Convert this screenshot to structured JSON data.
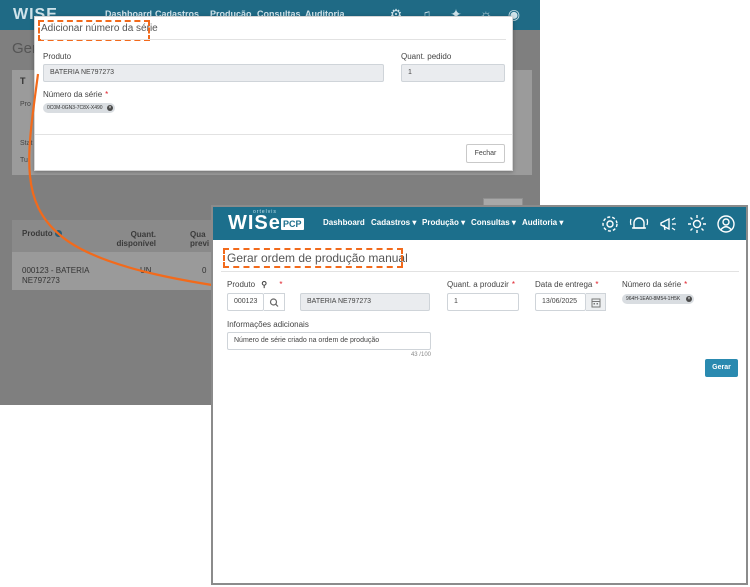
{
  "background_app": {
    "brand": "WISE",
    "nav": [
      "Dashboard",
      "Cadastros",
      "Produção",
      "Consultas",
      "Auditoria"
    ],
    "page_title": "Gera",
    "card_title": "T",
    "card_label_a": "Pro",
    "card_label_b": "Stat",
    "card_label_c": "Tu",
    "table_headers": [
      "Produto",
      "Quant. disponível",
      "Qua previ"
    ],
    "table_row": {
      "product_line1": "000123 - BATERIA",
      "product_line2": "NE797273",
      "unit": "UN",
      "qty": "0"
    }
  },
  "modal": {
    "title": "Adicionar número da série",
    "produto_label": "Produto",
    "produto_value": "BATERIA NE797273",
    "quant_label": "Quant. pedido",
    "quant_value": "1",
    "serie_label": "Número da série",
    "serie_required": "*",
    "serie_chip": "0C0M-0GN3-7C8X-X490",
    "fechar_label": "Fechar"
  },
  "window": {
    "brand": "WISe",
    "brand_badge": "PCP",
    "brand_sub": "ortelvis",
    "nav": {
      "dashboard": "Dashboard",
      "cadastros": "Cadastros",
      "producao": "Produção",
      "consultas": "Consultas",
      "auditoria": "Auditoria"
    },
    "page_title": "Gerar ordem de produção manual",
    "form": {
      "produto_label": "Produto",
      "produto_required": "*",
      "produto_code": "000123",
      "produto_name": "BATERIA NE797273",
      "quant_label": "Quant. a produzir",
      "quant_required": "*",
      "quant_value": "1",
      "data_label": "Data de entrega",
      "data_required": "*",
      "data_value": "13/06/2025",
      "serie_label": "Número da série",
      "serie_required": "*",
      "serie_chip": "964H-1EA0-8M54-1H5K",
      "info_label": "Informações adicionais",
      "info_value": "Número de série criado na ordem de produção",
      "char_count": "43 /100"
    },
    "gerar_label": "Gerar"
  },
  "colors": {
    "accent": "#1c6f8c",
    "highlight": "#f26a1b",
    "button": "#2a8ab0"
  }
}
